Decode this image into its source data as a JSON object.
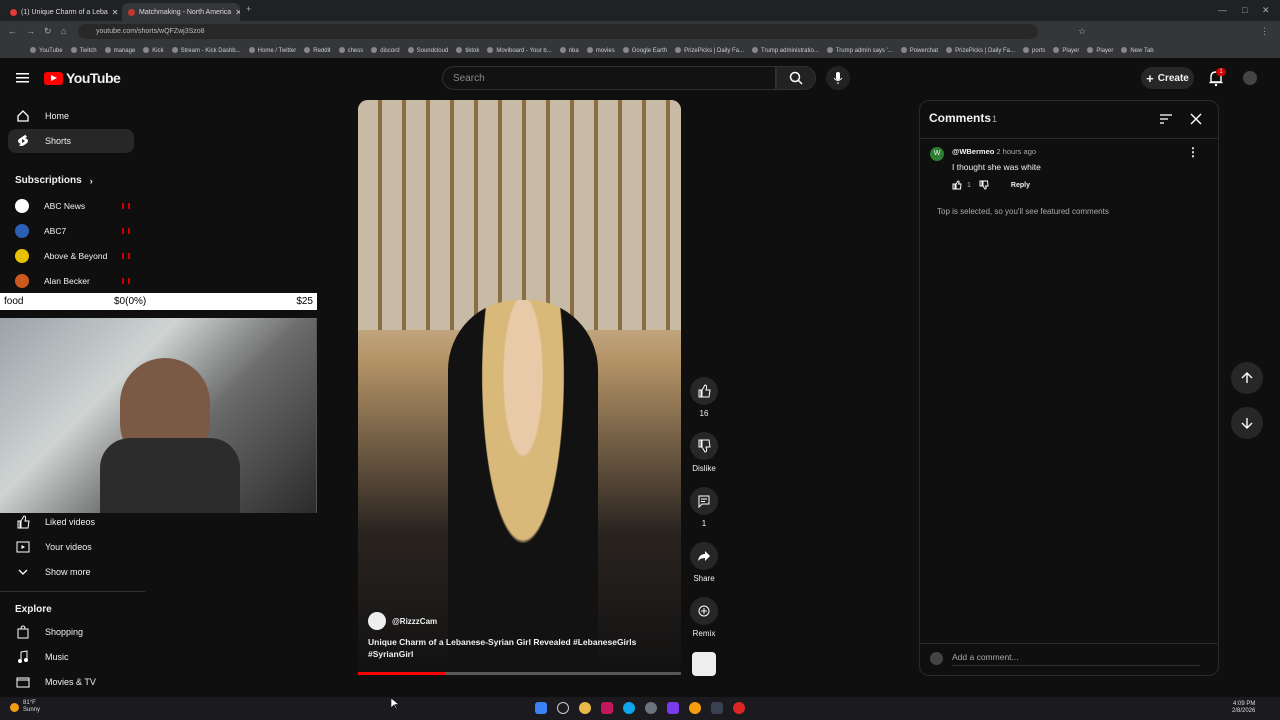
{
  "browser": {
    "tabs": [
      {
        "label": "(1) Unique Charm of a Leba",
        "active": true
      },
      {
        "label": "Matchmaking - North America",
        "active": false
      }
    ],
    "url": "youtube.com/shorts/wQFZwj3Szo8",
    "bookmarks": [
      "YouTube",
      "Twitch",
      "manage",
      "Kick",
      "Stream - Kick Dashb...",
      "Home / Twitter",
      "Reddit",
      "chess",
      "discord",
      "Soundcloud",
      "tiktok",
      "Moviboard - Your b...",
      "nba",
      "movies",
      "Google Earth",
      "PrizePicks | Daily Fa...",
      "Trump administratio...",
      "Trump admin says '...",
      "Powerchat",
      "PrizePicks | Daily Fa...",
      "ports",
      "Player",
      "Player",
      "New Tab"
    ]
  },
  "header": {
    "logo_text": "YouTube",
    "search_placeholder": "Search",
    "create_label": "Create",
    "notification_count": "1"
  },
  "sidebar": {
    "items": [
      {
        "label": "Home",
        "icon": "home-icon"
      },
      {
        "label": "Shorts",
        "icon": "shorts-icon",
        "active": true
      }
    ],
    "subscriptions_title": "Subscriptions",
    "subscriptions": [
      {
        "label": "ABC News",
        "color": "#ffffff"
      },
      {
        "label": "ABC7",
        "color": "#2b5fb3"
      },
      {
        "label": "Above & Beyond",
        "color": "#e6c200"
      },
      {
        "label": "Alan Becker",
        "color": "#cc5a20"
      }
    ],
    "you_items": [
      {
        "label": "Liked videos",
        "icon": "thumb-up-icon"
      },
      {
        "label": "Your videos",
        "icon": "video-icon"
      },
      {
        "label": "Show more",
        "icon": "chevron-down-icon"
      }
    ],
    "explore_title": "Explore",
    "explore_items": [
      {
        "label": "Shopping",
        "icon": "shopping-bag-icon"
      },
      {
        "label": "Music",
        "icon": "music-icon"
      },
      {
        "label": "Movies & TV",
        "icon": "film-icon"
      }
    ]
  },
  "stream_overlay": {
    "label": "food",
    "progress": "$0(0%)",
    "goal": "$25"
  },
  "short": {
    "channel": "@RizzzCam",
    "title": "Unique Charm of a Lebanese-Syrian Girl Revealed #LebaneseGirls #SyrianGirl",
    "progress_fraction": 0.27,
    "actions": {
      "like_count": "16",
      "dislike_label": "Dislike",
      "comment_count": "1",
      "share_label": "Share",
      "remix_label": "Remix"
    }
  },
  "comments": {
    "title": "Comments",
    "count": "1",
    "items": [
      {
        "avatar_letter": "W",
        "user": "@WBermeo",
        "time": "2 hours ago",
        "text": "I thought she was white",
        "likes": "1",
        "reply_label": "Reply"
      }
    ],
    "note": "Top is selected, so you'll see featured comments",
    "input_placeholder": "Add a comment..."
  },
  "taskbar": {
    "weather_temp": "81°F",
    "weather_desc": "Sunny",
    "time": "4:09 PM",
    "date": "2/8/2026"
  }
}
